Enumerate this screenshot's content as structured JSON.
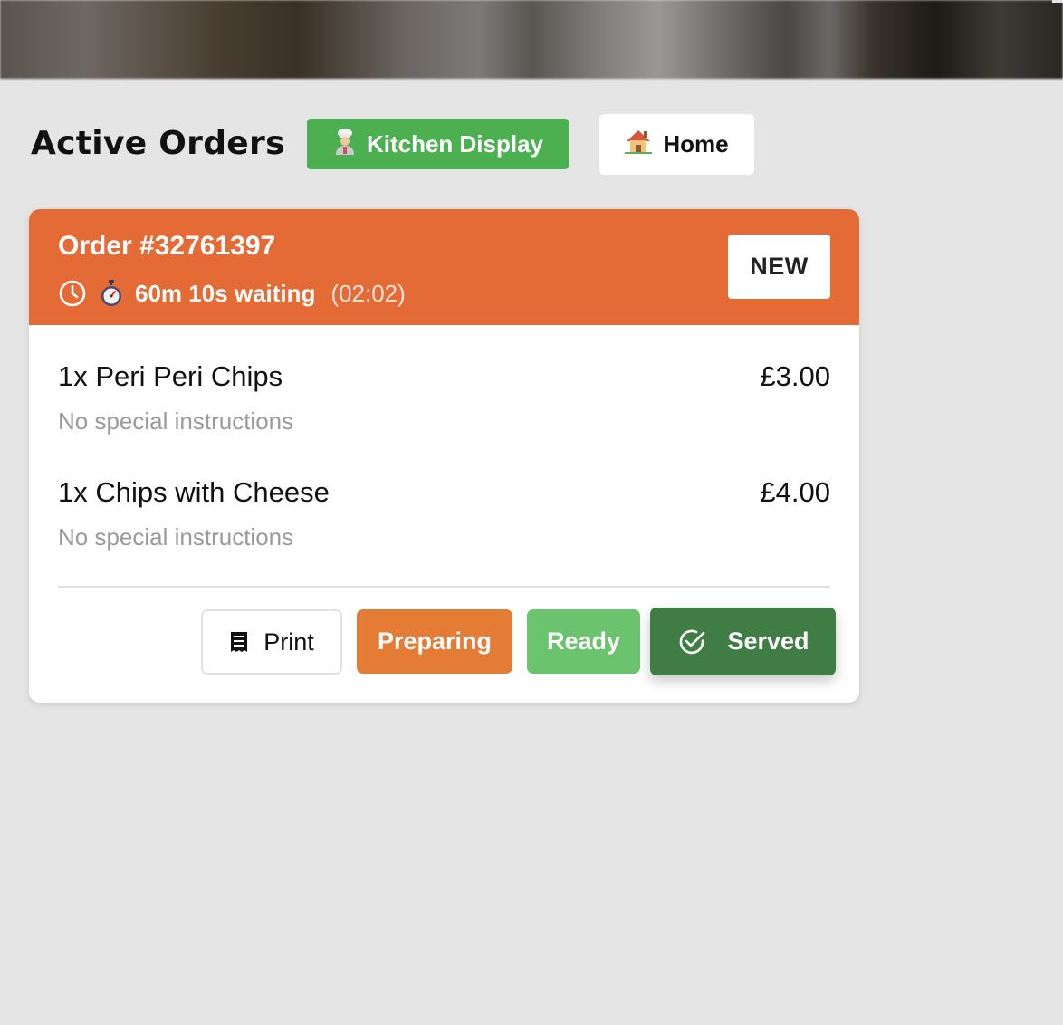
{
  "header": {
    "title": "Active Orders",
    "kitchen_button": {
      "icon": "chef-emoji",
      "label": "Kitchen Display"
    },
    "home_button": {
      "icon": "house-emoji",
      "label": "Home"
    }
  },
  "order": {
    "number": "Order #32761397",
    "status_badge": "NEW",
    "waiting": "60m 10s waiting",
    "elapsed": "(02:02)",
    "header_color": "#e46a36",
    "items": [
      {
        "name": "1x Peri Peri Chips",
        "price": "£3.00",
        "note": "No special instructions"
      },
      {
        "name": "1x Chips with Cheese",
        "price": "£4.00",
        "note": "No special instructions"
      }
    ],
    "actions": {
      "print": "Print",
      "preparing": "Preparing",
      "ready": "Ready",
      "served": "Served"
    }
  },
  "colors": {
    "kitchen_green": "#4caf50",
    "preparing_orange": "#e57c35",
    "ready_green": "#6cc36d",
    "served_green": "#3f7d44",
    "background": "#e5e5e5"
  }
}
